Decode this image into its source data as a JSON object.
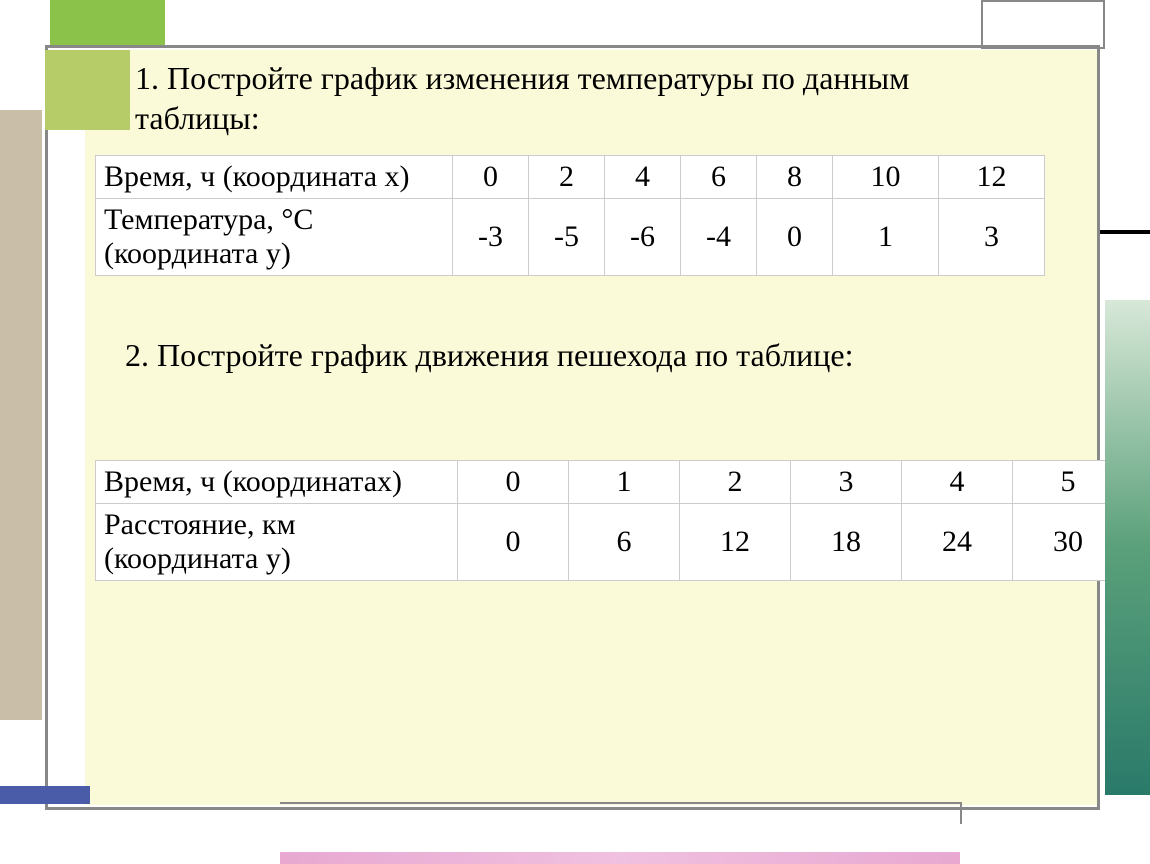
{
  "task1": {
    "prompt": "1. Постройте график изменения температуры по данным таблицы:",
    "row1_label": "Время, ч (координата х)",
    "row2_label": "Температура, °С (координата у)",
    "cols": [
      "0",
      "2",
      "4",
      "6",
      "8",
      "10",
      "12"
    ],
    "vals": [
      "-3",
      "-5",
      "-6",
      "-4",
      "0",
      "1",
      "3"
    ]
  },
  "task2": {
    "prompt": "2. Постройте график движения пешехода по таблице:",
    "row1_label": "Время, ч (координатах)",
    "row2_label": "Расстояние, км (координата у)",
    "cols": [
      "0",
      "1",
      "2",
      "3",
      "4",
      "5"
    ],
    "vals": [
      "0",
      "6",
      "12",
      "18",
      "24",
      "30"
    ]
  },
  "chart_data": [
    {
      "type": "table",
      "title": "Изменение температуры",
      "xlabel": "Время, ч (координата х)",
      "ylabel": "Температура, °С (координата у)",
      "x": [
        0,
        2,
        4,
        6,
        8,
        10,
        12
      ],
      "y": [
        -3,
        -5,
        -6,
        -4,
        0,
        1,
        3
      ]
    },
    {
      "type": "table",
      "title": "Движение пешехода",
      "xlabel": "Время, ч (координатах)",
      "ylabel": "Расстояние, км (координата у)",
      "x": [
        0,
        1,
        2,
        3,
        4,
        5
      ],
      "y": [
        0,
        6,
        12,
        18,
        24,
        30
      ]
    }
  ]
}
